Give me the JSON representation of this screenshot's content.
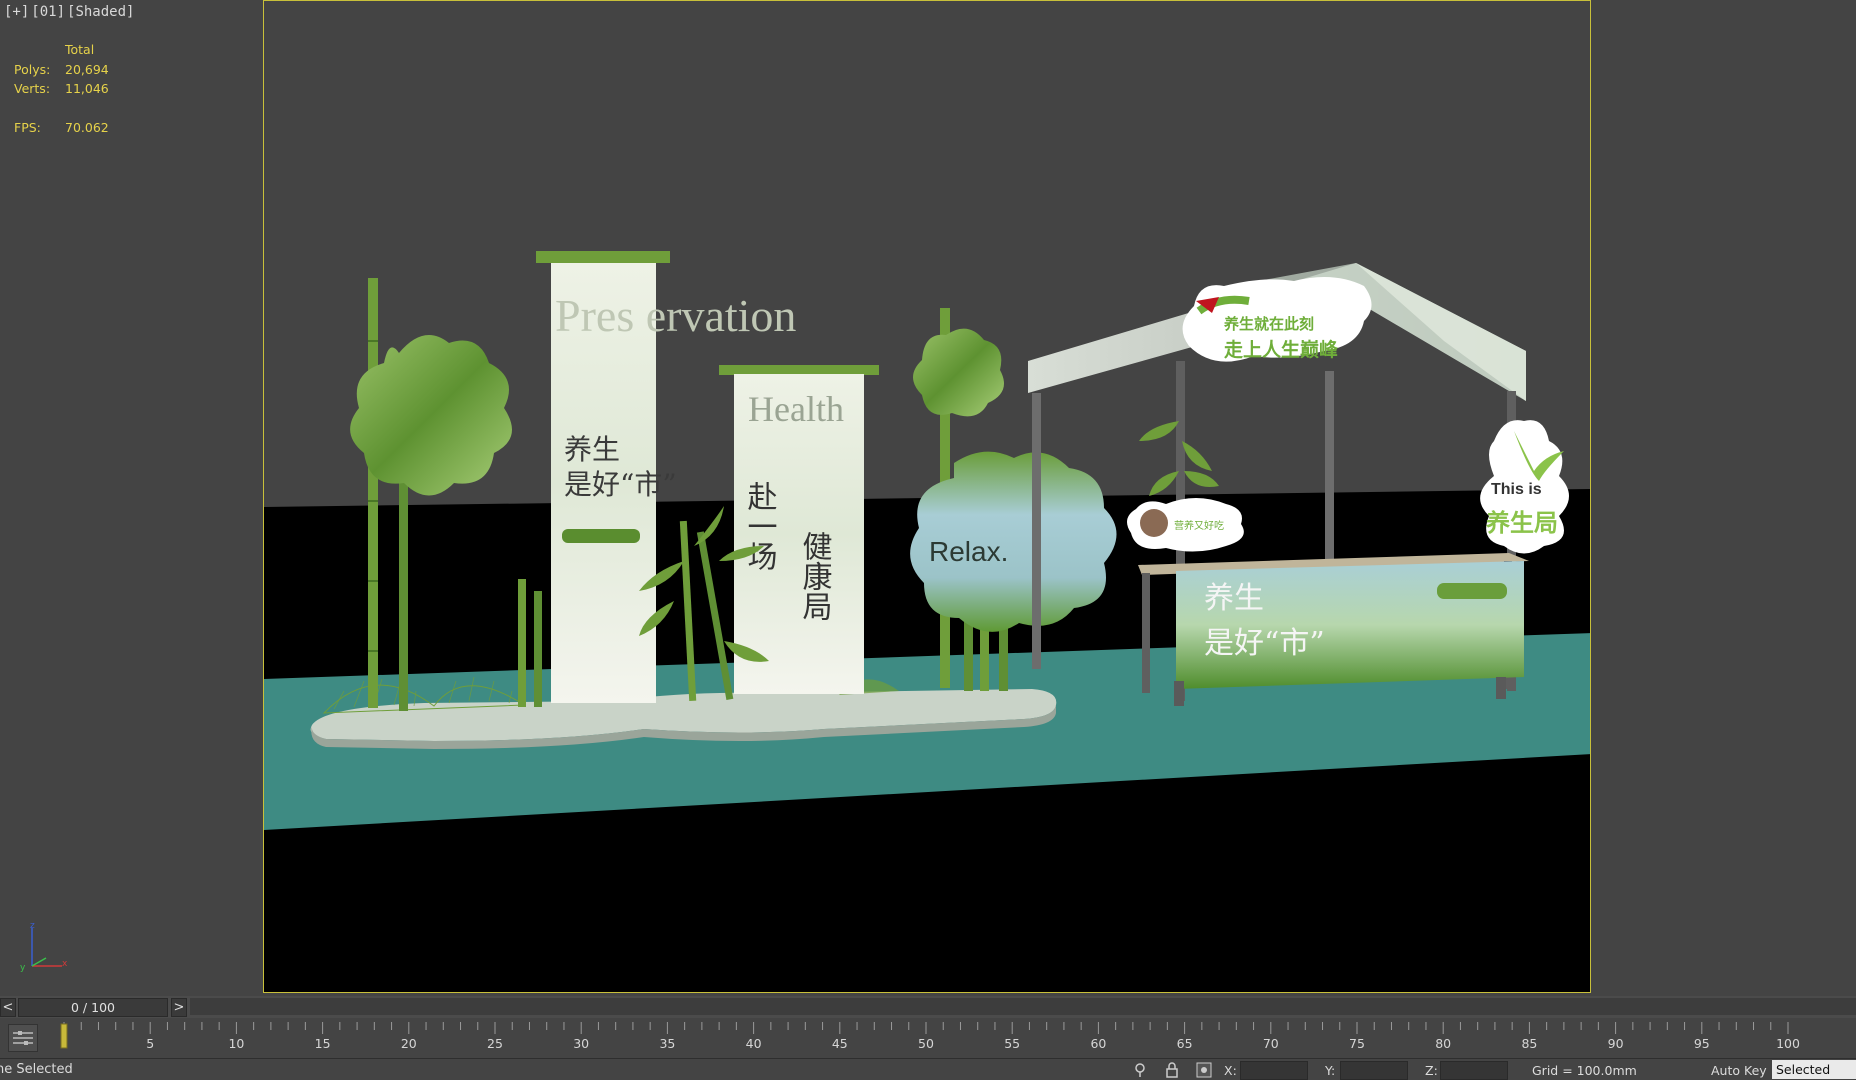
{
  "viewport": {
    "label_parts": [
      "[+]",
      "[01]",
      "[Shaded]"
    ],
    "stats": {
      "header": "Total",
      "polys_label": "Polys:",
      "polys_value": "20,694",
      "verts_label": "Verts:",
      "verts_value": "11,046",
      "fps_label": "FPS:",
      "fps_value": "70.062"
    }
  },
  "scene": {
    "banner1": {
      "title": "Pres ervation",
      "line1": "养生",
      "line2": "是好“市”"
    },
    "banner2": {
      "title": "Health",
      "col1": "赴一场",
      "col2": "健康局"
    },
    "relax_sign": "Relax.",
    "tent_sign_line1": "养生就在此刻",
    "tent_sign_line2": "走上人生巅峰",
    "left_badge": "营养又好吃",
    "right_figure_text": "This is",
    "right_figure_sub": "养生局",
    "counter_line1": "养生",
    "counter_line2": "是好“市”"
  },
  "timeline": {
    "prev_label": "<",
    "next_label": ">",
    "frame_display": "0 / 100",
    "tick_labels": [
      "5",
      "10",
      "15",
      "20",
      "25",
      "30",
      "35",
      "40",
      "45",
      "50",
      "55",
      "60",
      "65",
      "70",
      "75",
      "80",
      "85",
      "90",
      "95",
      "100"
    ]
  },
  "status": {
    "message": "ne Selected",
    "x_label": "X:",
    "y_label": "Y:",
    "z_label": "Z:",
    "grid": "Grid = 100.0mm",
    "autokey": "Auto Key",
    "selection_mode": "Selected"
  },
  "colors": {
    "viewport_bg": "#444444",
    "frame_border": "#c8c03a",
    "stats_text": "#e6d24a",
    "floor": "#3e8b83",
    "bamboo": "#6f9e3a"
  }
}
